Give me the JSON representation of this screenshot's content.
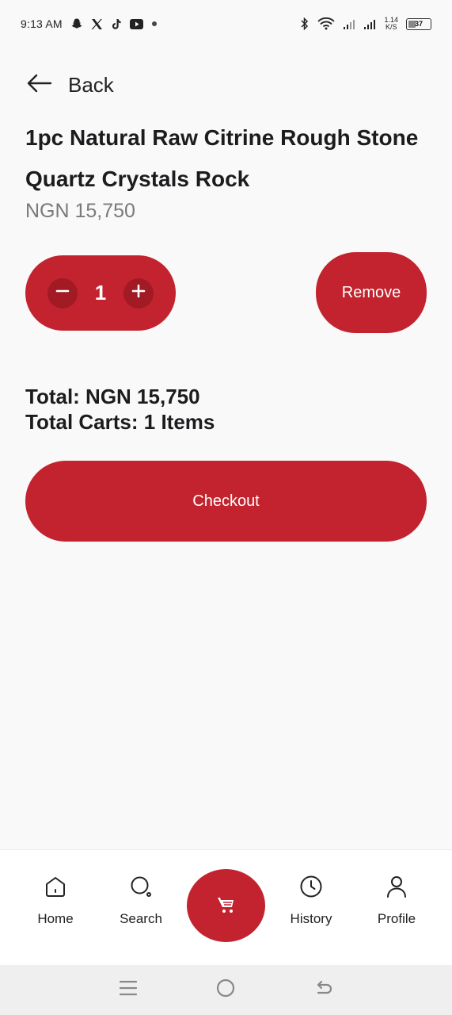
{
  "status_bar": {
    "time": "9:13 AM",
    "icons_left": [
      "snapchat-icon",
      "x-icon",
      "tiktok-icon",
      "youtube-icon",
      "dot-icon"
    ],
    "net_speed_value": "1.14",
    "net_speed_unit": "K/S",
    "battery_level": "37"
  },
  "header": {
    "back_label": "Back"
  },
  "product": {
    "title": "1pc Natural Raw Citrine Rough Stone Quartz Crystals Rock",
    "price": "NGN 15,750"
  },
  "cart_item": {
    "quantity": "1",
    "remove_label": "Remove"
  },
  "totals": {
    "total": "Total: NGN 15,750",
    "total_carts": "Total Carts: 1 Items"
  },
  "checkout_label": "Checkout",
  "bottom_nav": {
    "home": "Home",
    "search": "Search",
    "history": "History",
    "profile": "Profile"
  },
  "colors": {
    "accent": "#c2232e",
    "accent_dark": "#a11a24",
    "price_gray": "#7a7a7a",
    "background": "#f9f9fa"
  }
}
